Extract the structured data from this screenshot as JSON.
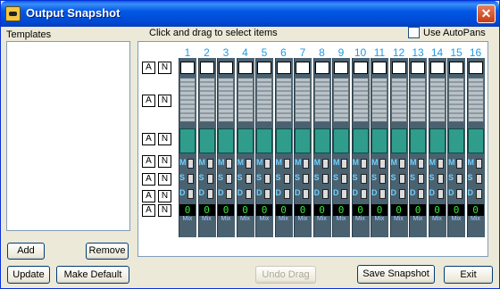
{
  "window": {
    "title": "Output Snapshot"
  },
  "templates": {
    "label": "Templates",
    "add": "Add",
    "remove": "Remove",
    "update": "Update",
    "make_default": "Make Default"
  },
  "grid": {
    "hint": "Click and drag to select items",
    "use_autopans": "Use AutoPans",
    "columns": [
      "1",
      "2",
      "3",
      "4",
      "5",
      "6",
      "7",
      "8",
      "9",
      "10",
      "11",
      "12",
      "13",
      "14",
      "15",
      "16"
    ],
    "row_a": "A",
    "row_n": "N",
    "toggle_labels": [
      "M",
      "S",
      "D"
    ],
    "digit_value": "0",
    "mix_label": "Mix"
  },
  "footer": {
    "undo_drag": "Undo Drag",
    "save_snapshot": "Save Snapshot",
    "exit": "Exit"
  },
  "colors": {
    "title_blue": "#0054e3",
    "strip": "#4a6170",
    "teal": "#2f9c8c",
    "number_blue": "#1e9be8",
    "digit_green": "#37e83b"
  }
}
